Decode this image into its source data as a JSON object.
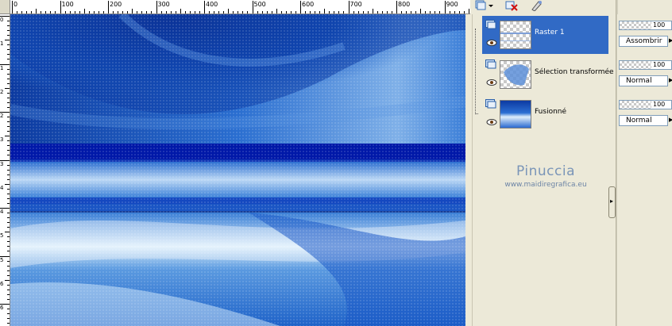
{
  "ruler": {
    "top_labels": [
      "0",
      "100",
      "200",
      "300",
      "400",
      "500",
      "600",
      "700",
      "800",
      "900"
    ],
    "left_labels": [
      "0",
      "1",
      "1",
      "2",
      "2",
      "3",
      "3",
      "4",
      "4",
      "5",
      "5",
      "6",
      "6",
      "7"
    ]
  },
  "layers_toolbar": {
    "icons": [
      "new-layer-icon",
      "dropdown-arrow-icon",
      "delete-layer-icon",
      "edit-mask-icon"
    ]
  },
  "layers": [
    {
      "name": "Raster 1",
      "selected": true,
      "thumb": "raster-thumb"
    },
    {
      "name": "Sélection transformée",
      "selected": false,
      "thumb": "selection-thumb"
    },
    {
      "name": "Fusionné",
      "selected": false,
      "thumb": "merged-thumb"
    }
  ],
  "watermark": {
    "name": "Pinuccia",
    "url": "www.maidiregrafica.eu"
  },
  "properties": [
    {
      "opacity": "100",
      "blend": "Assombrir"
    },
    {
      "opacity": "100",
      "blend": "Normal"
    },
    {
      "opacity": "100",
      "blend": "Normal"
    }
  ],
  "colors": {
    "selection": "#316ac5",
    "panel": "#ece9d8",
    "canvas_deep": "#0018a8",
    "canvas_mid": "#1d5fc7",
    "watermark": "#7a95b8"
  }
}
